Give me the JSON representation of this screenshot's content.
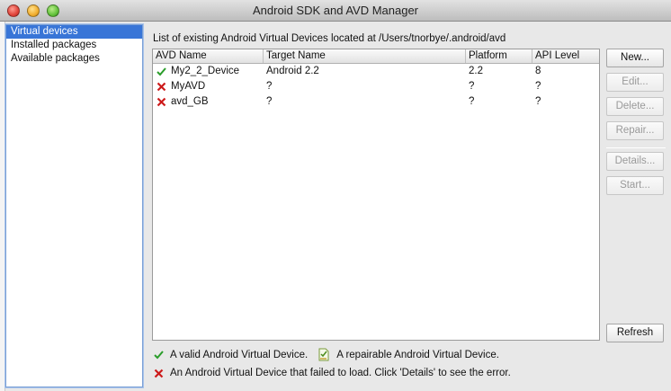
{
  "window": {
    "title": "Android SDK and AVD Manager"
  },
  "sidebar": {
    "items": [
      {
        "label": "Virtual devices",
        "selected": true
      },
      {
        "label": "Installed packages",
        "selected": false
      },
      {
        "label": "Available packages",
        "selected": false
      }
    ]
  },
  "main": {
    "header": "List of existing Android Virtual Devices located at /Users/tnorbye/.android/avd",
    "columns": [
      "AVD Name",
      "Target Name",
      "Platform",
      "API Level"
    ],
    "rows": [
      {
        "status": "valid",
        "status_icon": "check-icon",
        "name": "My2_2_Device",
        "target": "Android 2.2",
        "platform": "2.2",
        "api": "8"
      },
      {
        "status": "failed",
        "status_icon": "error-x-icon",
        "name": "MyAVD",
        "target": "?",
        "platform": "?",
        "api": "?"
      },
      {
        "status": "failed",
        "status_icon": "error-x-icon",
        "name": "avd_GB",
        "target": "?",
        "platform": "?",
        "api": "?"
      }
    ]
  },
  "buttons": {
    "new": "New...",
    "edit": "Edit...",
    "delete": "Delete...",
    "repair": "Repair...",
    "details": "Details...",
    "start": "Start...",
    "refresh": "Refresh"
  },
  "legend": {
    "valid": "A valid Android Virtual Device.",
    "repairable": "A repairable Android Virtual Device.",
    "failed": "An Android Virtual Device that failed to load. Click 'Details' to see the error."
  },
  "colors": {
    "valid": "#2a9d2a",
    "failed": "#cc1a1a",
    "selection": "#3875d7"
  }
}
